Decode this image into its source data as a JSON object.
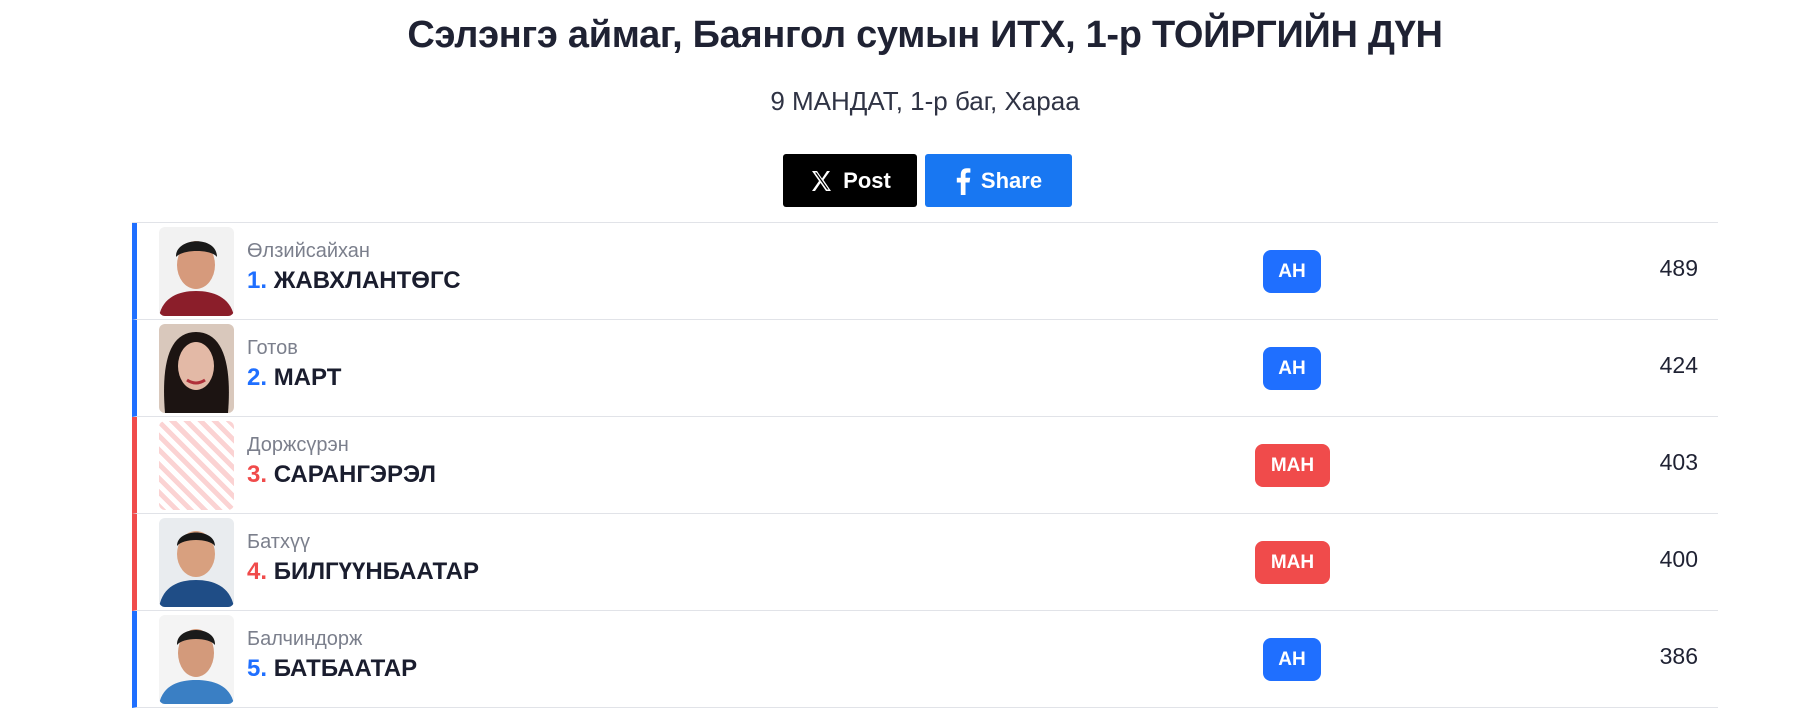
{
  "header": {
    "title": "Сэлэнгэ аймаг, Баянгол сумын ИТХ, 1-р ТОЙРГИЙН ДҮН",
    "subtitle": "9 МАНДАТ, 1-р баг, Хараа"
  },
  "share": {
    "x_label": "Post",
    "fb_label": "Share"
  },
  "candidates": [
    {
      "patronymic": "Өлзийсайхан",
      "number": "1.",
      "name": "ЖАВХЛАНТӨГС",
      "party": "АН",
      "votes": "489"
    },
    {
      "patronymic": "Готов",
      "number": "2.",
      "name": "МАРТ",
      "party": "АН",
      "votes": "424"
    },
    {
      "patronymic": "Доржсүрэн",
      "number": "3.",
      "name": "САРАНГЭРЭЛ",
      "party": "МАН",
      "votes": "403"
    },
    {
      "patronymic": "Батхүү",
      "number": "4.",
      "name": "БИЛГҮҮНБААТАР",
      "party": "МАН",
      "votes": "400"
    },
    {
      "patronymic": "Балчиндорж",
      "number": "5.",
      "name": "БАТБААТАР",
      "party": "АН",
      "votes": "386"
    }
  ],
  "colors": {
    "ah": "#1f6fff",
    "man": "#f04b4b",
    "x_button": "#000000",
    "fb_button": "#1877f2"
  },
  "icons": {
    "x": "x-logo-icon",
    "fb": "facebook-icon"
  }
}
